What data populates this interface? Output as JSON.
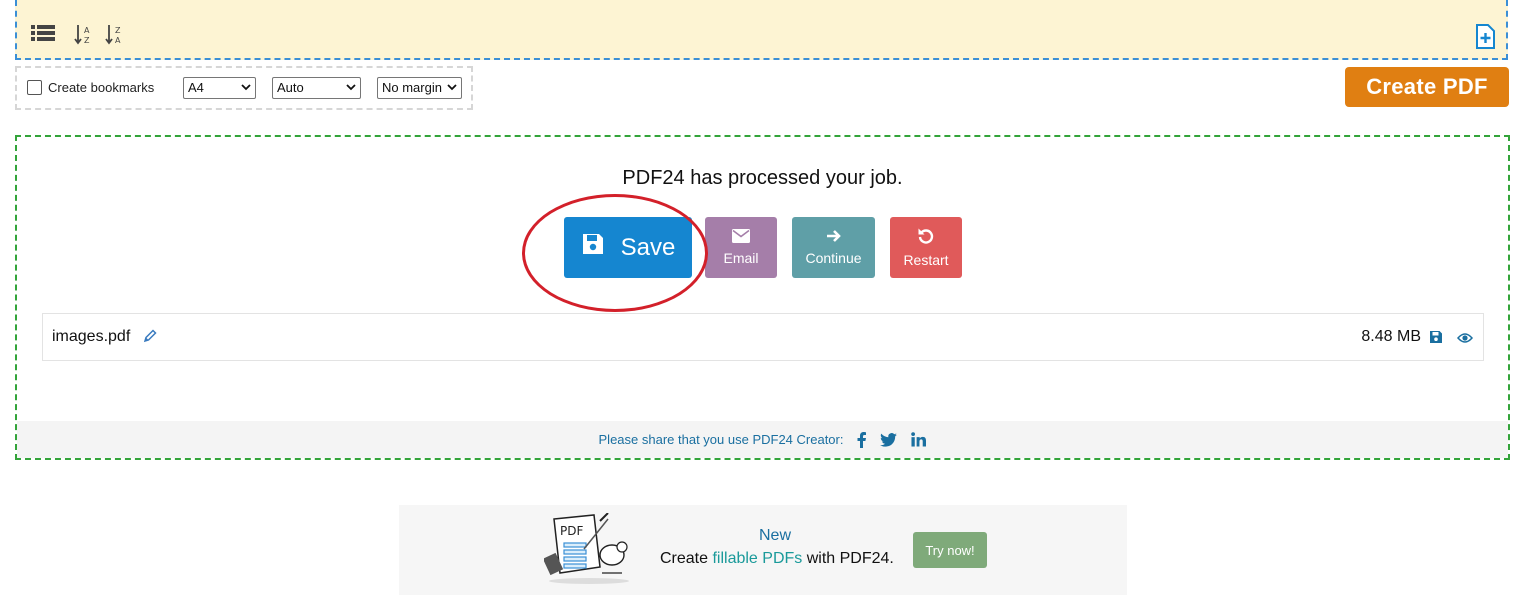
{
  "toolbar": {
    "list_icon": "list-icon",
    "sort_az_icon": "sort-az-icon",
    "sort_za_icon": "sort-za-icon",
    "add_file_icon": "add-file-icon"
  },
  "options": {
    "bookmarks_label": "Create bookmarks",
    "bookmarks_checked": false,
    "page_size": "A4",
    "orientation": "Auto",
    "margin": "No margin"
  },
  "create_pdf_label": "Create PDF",
  "result": {
    "title": "PDF24 has processed your job.",
    "buttons": {
      "save": "Save",
      "email": "Email",
      "continue": "Continue",
      "restart": "Restart"
    },
    "file": {
      "name": "images.pdf",
      "size": "8.48 MB"
    },
    "share_text": "Please share that you use PDF24 Creator:"
  },
  "promo": {
    "new_label": "New",
    "text_before": "Create ",
    "text_link": "fillable PDFs",
    "text_after": " with PDF24.",
    "button": "Try now!"
  },
  "colors": {
    "save": "#1586d0",
    "email": "#a57ea9",
    "continue": "#5f9fa7",
    "restart": "#e05a5a",
    "create_pdf": "#e07f12",
    "highlight": "#d3202a"
  }
}
